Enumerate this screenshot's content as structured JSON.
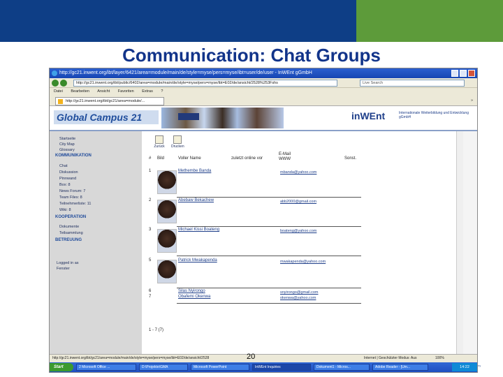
{
  "slide": {
    "title": "Communication: Chat Groups",
    "number": "20",
    "footer_text": "ny"
  },
  "browser": {
    "window_title": "http://gc21.inwent.org/ibt/layer/6421/area=module/main/de/style=myse/pers=myse/ibt=user/de/user - InWEnt gGmbH",
    "address": "http://gc21.inwent.org/ibt/public/6402/area=module/main/de/style=myse/pers=myse/ibt=E02/de/ansicht/2528%253Fshs",
    "search_placeholder": "Live Search",
    "menu": [
      "Datei",
      "Bearbeiten",
      "Ansicht",
      "Favoriten",
      "Extras",
      "?"
    ],
    "tab_label": "http://gc21.inwent.org/ibt/gc21/area=module/...",
    "tab_tools": "»"
  },
  "site": {
    "logo_text": "Global Campus 21",
    "banner_chip": "",
    "inwent_logo": "inWEnt",
    "inwent_tagline": "Internationale Weiterbildung und Entwicklung gGmbH"
  },
  "sidebar": {
    "top_items": [
      "Startseite",
      "City Map",
      "Glossary"
    ],
    "section1": "KOMMUNIKATION",
    "comm_items": [
      "Chat",
      "Diskussion",
      "Pinnwand",
      "Box: 8",
      "News Forum: 7",
      "Team Files: 8",
      "Teilnehmerliste: 11",
      "Wiki: 8"
    ],
    "section2": "KOOPERATION",
    "coop_items": [
      "Dokumente",
      "Teilsammlung"
    ],
    "section3": "BETREUUNG",
    "bottom_items": [
      "Logged in as",
      "Fenster"
    ]
  },
  "content": {
    "actions": [
      "Zurück",
      "Drucken"
    ],
    "columns": [
      "#",
      "Bild",
      "Voller Name",
      "zuletzt online vor",
      "E-Mail\nWWW",
      "Sonst."
    ],
    "members": [
      {
        "num": "1",
        "name": "Methembe Banda",
        "email": "mbanda@yahoo.com"
      },
      {
        "num": "2",
        "name": "Abebaw Bekachew",
        "email": "abb2000@gmail.com"
      },
      {
        "num": "3",
        "name": "Michael Kissi Boateng",
        "email": "boateng@yahoo.com"
      },
      {
        "num": "5",
        "name": "Patrick Mwakapenda",
        "email": "mwakapenda@yahoo.com"
      },
      {
        "num": "6",
        "name": "Silas Nyirongo",
        "email": "snyirongo@gmail.com"
      },
      {
        "num": "7",
        "name": "Obafemi Okenwa",
        "email": "okenwa@yahoo.com"
      }
    ],
    "count": "1 - 7 (7)"
  },
  "status": {
    "text": "http://gc21.inwent.org/ibt/gc21/area=module/main/de/style=myse/pers=myse/ibt=E02/de/ansicht/2528",
    "zone": "Internet | Geschützter Modus: Aus",
    "zoom": "100%"
  },
  "taskbar": {
    "start": "Start",
    "tasks": [
      "2 Microsoft Office ...",
      "D:\\Projekte\\GMA",
      "Microsoft PowerPoint",
      "InWEnt Inquiries",
      "Dokument1 - Micros...",
      "Adobe Reader - [Um..."
    ],
    "active_index": 3,
    "clock": "14:22"
  },
  "colors": {
    "header_dark": "#0e3e86",
    "header_green": "#5d9b3a",
    "title_blue": "#12348a",
    "link_blue": "#1f3f8a"
  }
}
